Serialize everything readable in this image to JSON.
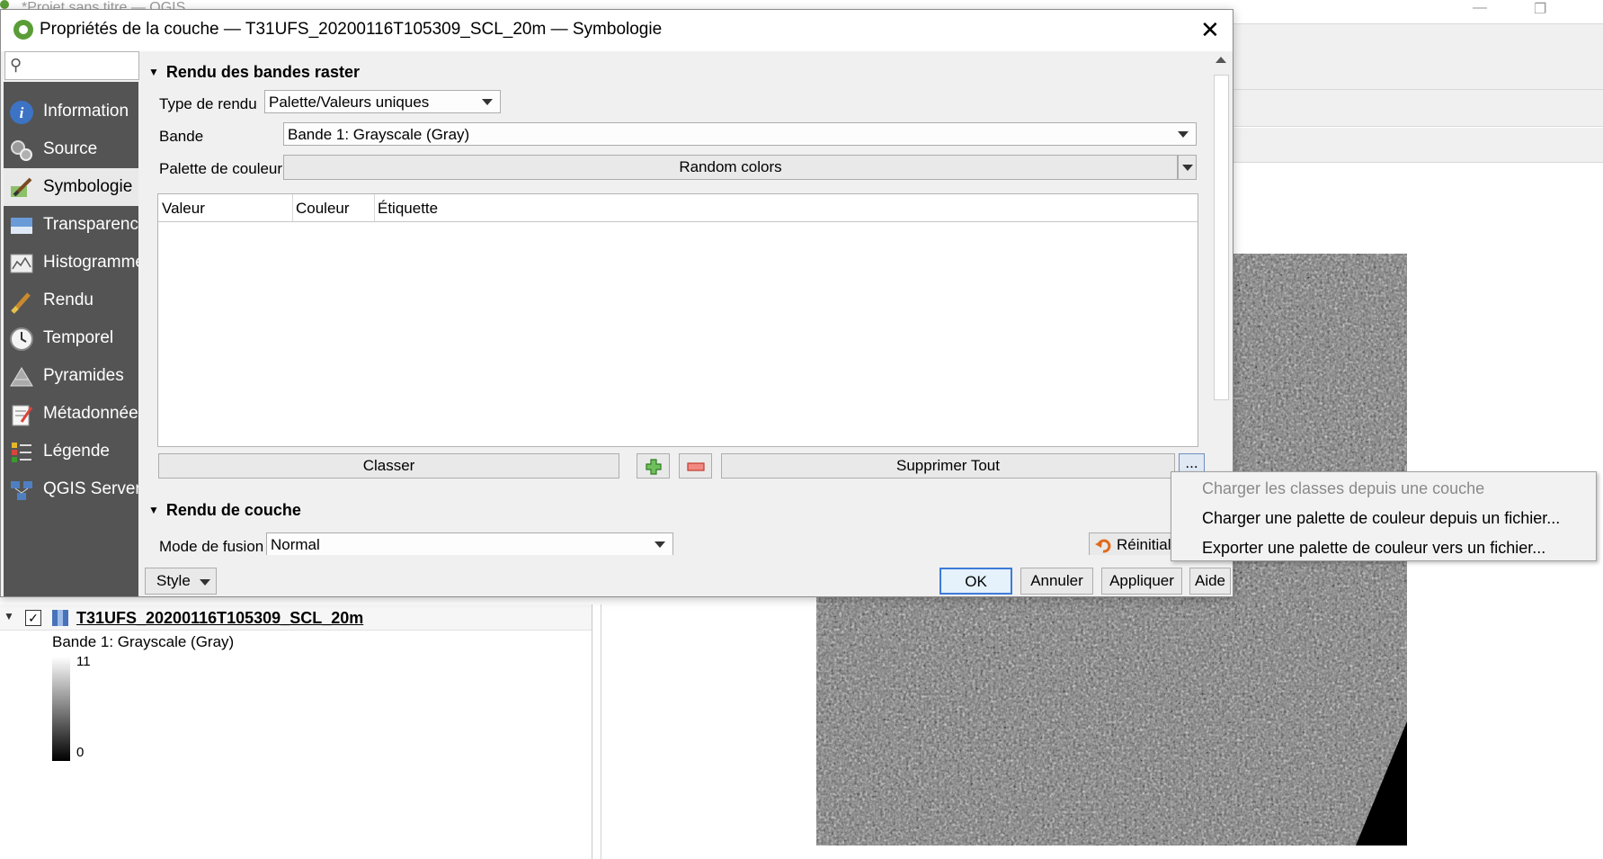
{
  "bg_window": {
    "title": "*Projet sans titre — QGIS",
    "minimize_glyph": "—",
    "restore_glyph": "❐"
  },
  "dialog": {
    "title": "Propriétés de la couche — T31UFS_20200116T105309_SCL_20m — Symbologie",
    "close_glyph": "✕",
    "search_placeholder": "",
    "sidebar": [
      {
        "label": "Information",
        "icon": "info-icon"
      },
      {
        "label": "Source",
        "icon": "source-icon"
      },
      {
        "label": "Symbologie",
        "icon": "symbology-icon"
      },
      {
        "label": "Transparence",
        "icon": "transparency-icon"
      },
      {
        "label": "Histogramme",
        "icon": "histogram-icon"
      },
      {
        "label": "Rendu",
        "icon": "rendering-icon"
      },
      {
        "label": "Temporel",
        "icon": "temporal-icon"
      },
      {
        "label": "Pyramides",
        "icon": "pyramids-icon"
      },
      {
        "label": "Métadonnées",
        "icon": "metadata-icon"
      },
      {
        "label": "Légende",
        "icon": "legend-icon"
      },
      {
        "label": "QGIS Server",
        "icon": "server-icon"
      }
    ],
    "active_item": "Symbologie",
    "band_rendering": {
      "header": "Rendu des bandes raster",
      "render_type_label": "Type de rendu",
      "render_type_value": "Palette/Valeurs uniques",
      "band_label": "Bande",
      "band_value": "Bande 1: Grayscale (Gray)",
      "palette_label": "Palette de couleur",
      "palette_value": "Random colors",
      "table_columns": [
        "Valeur",
        "Couleur",
        "Étiquette"
      ],
      "table_rows": [],
      "classify_button": "Classer",
      "add_button_glyph": "+",
      "remove_button_glyph": "−",
      "delete_all_button": "Supprimer Tout",
      "more_button": "..."
    },
    "layer_rendering": {
      "header": "Rendu de couche",
      "blend_label": "Mode de fusion",
      "blend_value": "Normal",
      "reset_button": "Réinitialis"
    },
    "footer": {
      "style_button": "Style",
      "ok_button": "OK",
      "cancel_button": "Annuler",
      "apply_button": "Appliquer",
      "help_button": "Aide"
    }
  },
  "popup_menu": [
    {
      "label": "Charger les classes depuis une couche",
      "enabled": false
    },
    {
      "label": "Charger une palette de couleur depuis un fichier...",
      "enabled": true
    },
    {
      "label": "Exporter une palette de couleur vers un fichier...",
      "enabled": true
    }
  ],
  "layers_panel": {
    "layer_name": "T31UFS_20200116T105309_SCL_20m",
    "checked": true,
    "band_label": "Bande 1: Grayscale (Gray)",
    "legend_max": "11",
    "legend_min": "0"
  },
  "colors": {
    "sidebar_bg": "#545454",
    "qgis_green": "#5a9d37",
    "add_green": "#3a9a2e",
    "remove_red": "#d9453b"
  }
}
